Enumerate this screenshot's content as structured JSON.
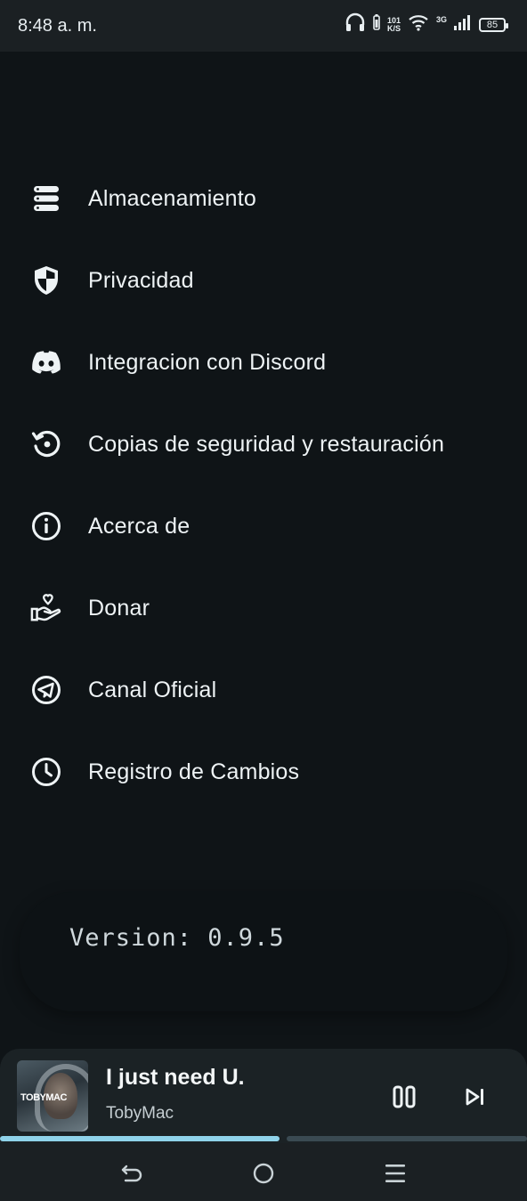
{
  "status_bar": {
    "time": "8:48 a. m.",
    "speed_value": "101",
    "speed_unit": "K/S",
    "network": "3G",
    "battery": "85",
    "icons": [
      "headphones-icon",
      "wifi-icon",
      "signal-icon",
      "battery-icon"
    ]
  },
  "menu": {
    "items": [
      {
        "label": "Almacenamiento",
        "icon": "storage-icon"
      },
      {
        "label": "Privacidad",
        "icon": "shield-icon"
      },
      {
        "label": "Integracion con Discord",
        "icon": "discord-icon"
      },
      {
        "label": "Copias de seguridad y restauración",
        "icon": "restore-icon"
      },
      {
        "label": "Acerca de",
        "icon": "info-icon"
      },
      {
        "label": "Donar",
        "icon": "donate-hand-heart-icon"
      },
      {
        "label": "Canal Oficial",
        "icon": "telegram-icon"
      },
      {
        "label": "Registro de Cambios",
        "icon": "clock-icon"
      }
    ]
  },
  "version": {
    "text": "Version: 0.9.5"
  },
  "player": {
    "title": "I just need U.",
    "artist": "TobyMac",
    "album_logo": "TOBYMAC",
    "progress": 0.53,
    "colors": {
      "played": "#8fd3ea",
      "remaining": "#3a4a52"
    }
  },
  "nav": {
    "icons": [
      "back-icon",
      "home-icon",
      "recents-icon"
    ]
  }
}
